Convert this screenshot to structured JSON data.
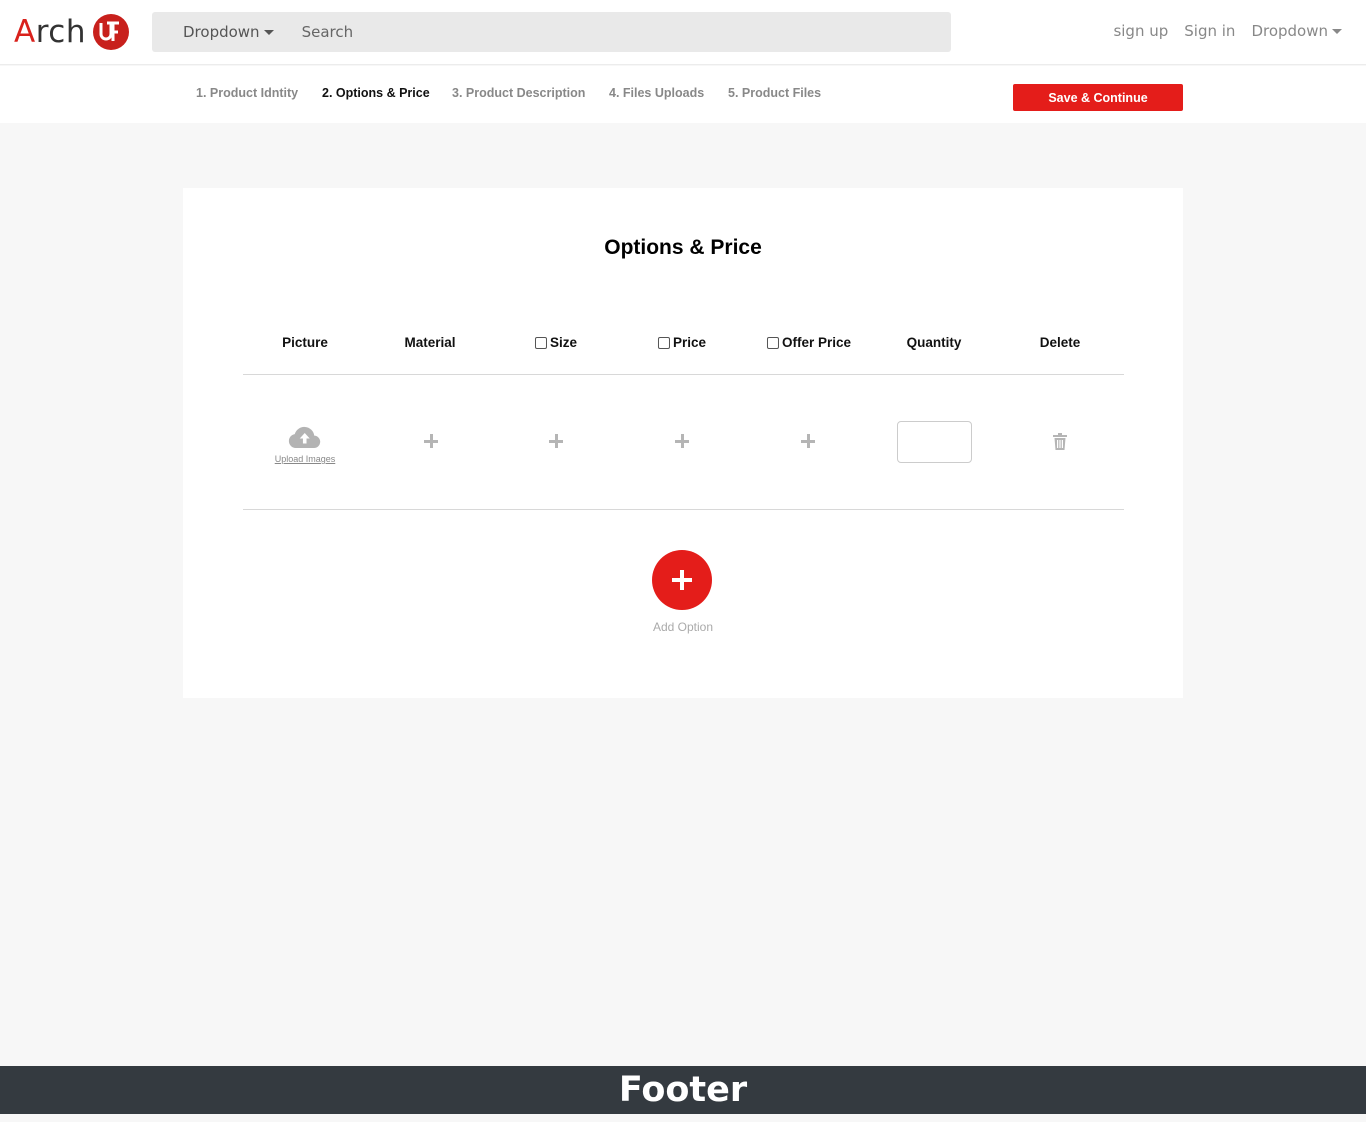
{
  "brand": {
    "logo_text_a": "A",
    "logo_text_rest": "rch",
    "badge_glyph": "ƱF",
    "accent_color": "#e41d1a"
  },
  "navbar": {
    "dropdown_label": "Dropdown",
    "search_placeholder": "Search",
    "sign_up": "sign up",
    "sign_in": "Sign in",
    "right_dropdown_label": "Dropdown"
  },
  "steps": [
    {
      "label": "1. Product Idntity",
      "active": false
    },
    {
      "label": "2. Options & Price",
      "active": true
    },
    {
      "label": "3. Product Description",
      "active": false
    },
    {
      "label": "4. Files Uploads",
      "active": false
    },
    {
      "label": "5. Product Files",
      "active": false
    }
  ],
  "save_button": "Save & Continue",
  "card": {
    "title": "Options & Price",
    "columns": [
      {
        "label": "Picture",
        "checkbox": false
      },
      {
        "label": "Material",
        "checkbox": false
      },
      {
        "label": "Size",
        "checkbox": true,
        "checked": false
      },
      {
        "label": "Price",
        "checkbox": true,
        "checked": false
      },
      {
        "label": "Offer Price",
        "checkbox": true,
        "checked": false
      },
      {
        "label": "Quantity",
        "checkbox": false
      },
      {
        "label": "Delete",
        "checkbox": false
      }
    ],
    "row": {
      "upload_label": "Upload Images",
      "upload_icon": "cloud-upload-icon",
      "add_icon": "plus-icon",
      "quantity_value": "",
      "delete_icon": "trash-icon"
    },
    "add_option_label": "Add Option"
  },
  "footer": {
    "text": "Footer"
  }
}
